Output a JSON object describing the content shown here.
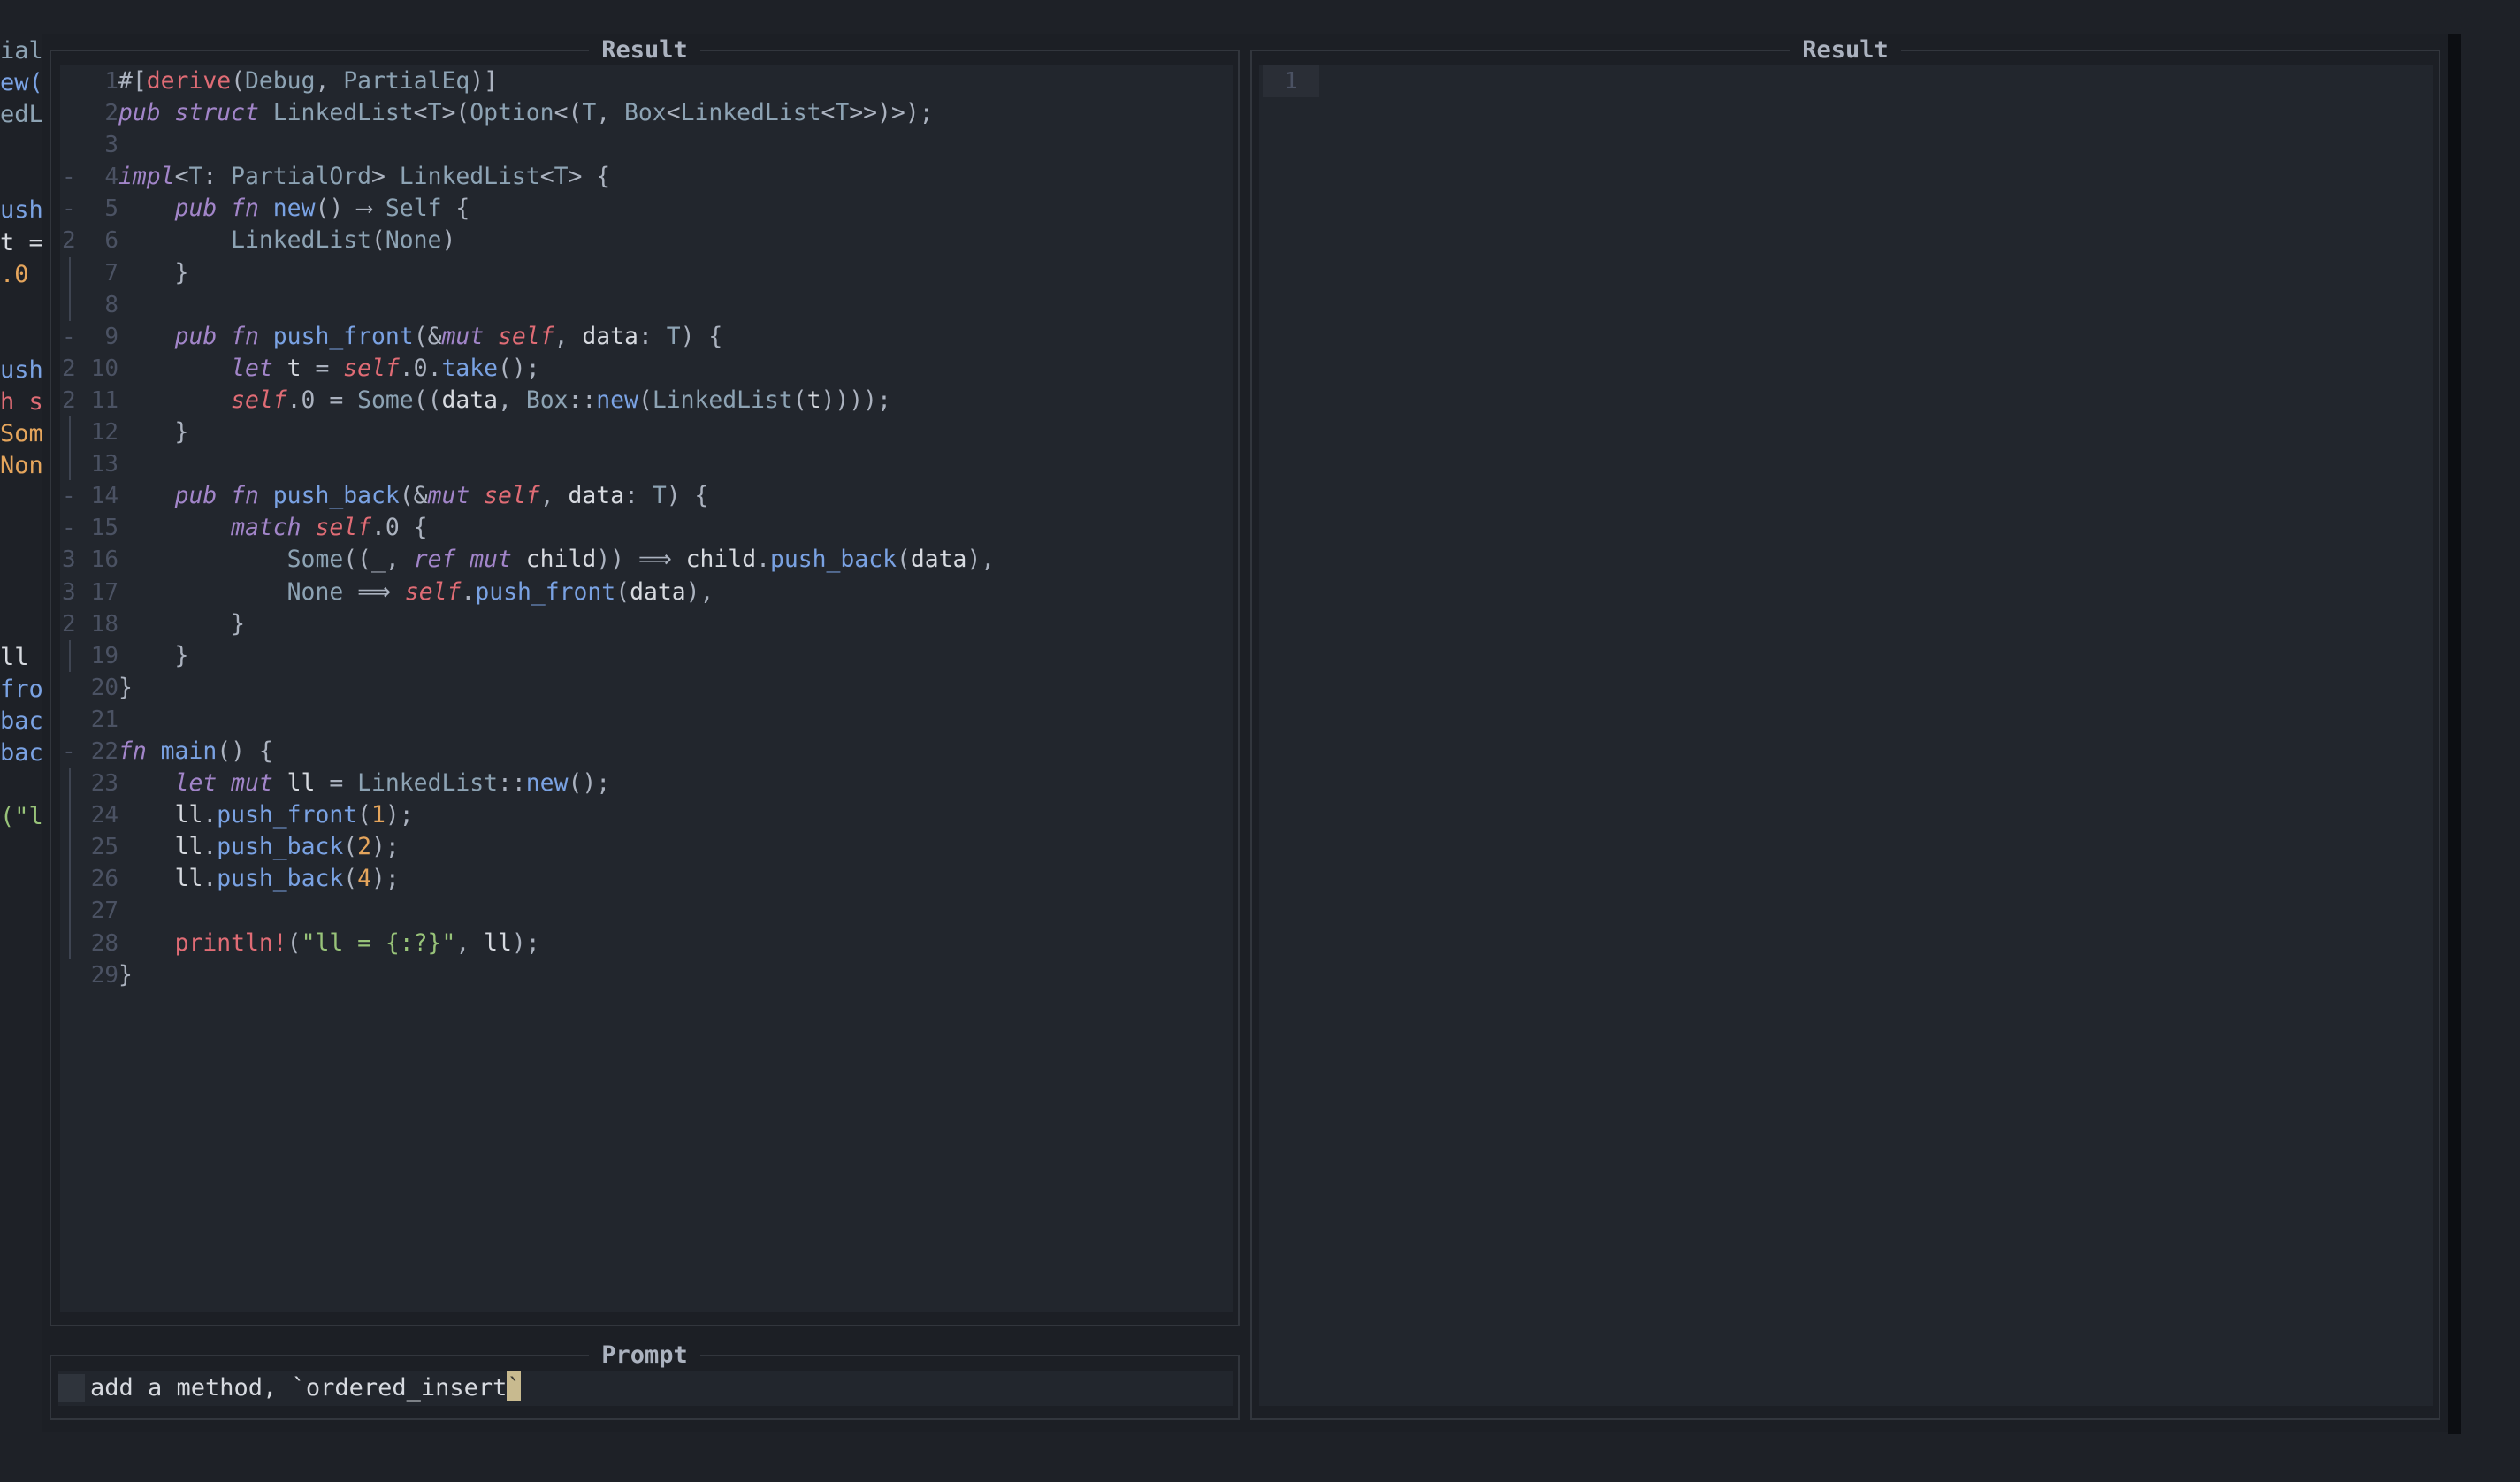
{
  "left_sliver": [
    {
      "text": "ial",
      "color": "#8da3b4"
    },
    {
      "text": "ew(",
      "color": "#7aa2e3"
    },
    {
      "text": "edL",
      "color": "#8da3b4"
    },
    {
      "text": "",
      "color": "#abb2bf"
    },
    {
      "text": "",
      "color": "#abb2bf"
    },
    {
      "text": "ush",
      "color": "#7aa2e3"
    },
    {
      "text": "t =",
      "color": "#d7dae0"
    },
    {
      "text": ".0",
      "color": "#e5a55c"
    },
    {
      "text": "",
      "color": "#abb2bf"
    },
    {
      "text": "",
      "color": "#abb2bf"
    },
    {
      "text": "ush",
      "color": "#7aa2e3"
    },
    {
      "text": "h s",
      "color": "#e06c75"
    },
    {
      "text": "Som",
      "color": "#e5a55c"
    },
    {
      "text": "Non",
      "color": "#e5a55c"
    },
    {
      "text": "",
      "color": "#abb2bf"
    },
    {
      "text": "",
      "color": "#abb2bf"
    },
    {
      "text": "",
      "color": "#abb2bf"
    },
    {
      "text": "",
      "color": "#abb2bf"
    },
    {
      "text": "",
      "color": "#abb2bf"
    },
    {
      "text": "ll",
      "color": "#d7dae0"
    },
    {
      "text": "fro",
      "color": "#7aa2e3"
    },
    {
      "text": "bac",
      "color": "#7aa2e3"
    },
    {
      "text": "bac",
      "color": "#7aa2e3"
    },
    {
      "text": "",
      "color": "#abb2bf"
    },
    {
      "text": "(\"l",
      "color": "#98c379"
    }
  ],
  "left_panel": {
    "title": "Result",
    "code_lines": [
      {
        "num": "1",
        "mark": "",
        "bar": false,
        "tokens": [
          [
            "#[",
            "pu"
          ],
          [
            "derive",
            "mac"
          ],
          [
            "(",
            "pu"
          ],
          [
            "Debug",
            "ty"
          ],
          [
            ", ",
            "pu"
          ],
          [
            "PartialEq",
            "ty"
          ],
          [
            ")]",
            "pu"
          ]
        ]
      },
      {
        "num": "2",
        "mark": "",
        "bar": false,
        "tokens": [
          [
            "pub struct ",
            "kw"
          ],
          [
            "LinkedList",
            "ty"
          ],
          [
            "<",
            "pu"
          ],
          [
            "T",
            "ty"
          ],
          [
            ">(",
            "pu"
          ],
          [
            "Option",
            "ty"
          ],
          [
            "<(",
            "pu"
          ],
          [
            "T",
            "ty"
          ],
          [
            ", ",
            "pu"
          ],
          [
            "Box",
            "ty"
          ],
          [
            "<",
            "pu"
          ],
          [
            "LinkedList",
            "ty"
          ],
          [
            "<",
            "pu"
          ],
          [
            "T",
            "ty"
          ],
          [
            ">>)>);",
            "pu"
          ]
        ]
      },
      {
        "num": "3",
        "mark": "",
        "bar": false,
        "tokens": []
      },
      {
        "num": "4",
        "mark": "-",
        "bar": false,
        "tokens": [
          [
            "impl",
            "kw"
          ],
          [
            "<",
            "pu"
          ],
          [
            "T",
            "ty"
          ],
          [
            ": ",
            "pu"
          ],
          [
            "PartialOrd",
            "ty"
          ],
          [
            "> ",
            "pu"
          ],
          [
            "LinkedList",
            "ty"
          ],
          [
            "<",
            "pu"
          ],
          [
            "T",
            "ty"
          ],
          [
            "> {",
            "pu"
          ]
        ]
      },
      {
        "num": "5",
        "mark": "-",
        "bar": false,
        "tokens": [
          [
            "    ",
            "pu"
          ],
          [
            "pub fn ",
            "kw"
          ],
          [
            "new",
            "fn"
          ],
          [
            "() ⟶ ",
            "pu"
          ],
          [
            "Self",
            "ty"
          ],
          [
            " {",
            "pu"
          ]
        ]
      },
      {
        "num": "6",
        "mark": "2",
        "bar": false,
        "tokens": [
          [
            "        ",
            "pu"
          ],
          [
            "LinkedList",
            "ty"
          ],
          [
            "(",
            "pu"
          ],
          [
            "None",
            "ty"
          ],
          [
            ")",
            "pu"
          ]
        ]
      },
      {
        "num": "7",
        "mark": "",
        "bar": true,
        "tokens": [
          [
            "    }",
            "pu"
          ]
        ]
      },
      {
        "num": "8",
        "mark": "",
        "bar": true,
        "tokens": []
      },
      {
        "num": "9",
        "mark": "-",
        "bar": false,
        "tokens": [
          [
            "    ",
            "pu"
          ],
          [
            "pub fn ",
            "kw"
          ],
          [
            "push_front",
            "fn"
          ],
          [
            "(&",
            "pu"
          ],
          [
            "mut ",
            "kw"
          ],
          [
            "self",
            "self"
          ],
          [
            ", ",
            "pu"
          ],
          [
            "data",
            "idt"
          ],
          [
            ": ",
            "pu"
          ],
          [
            "T",
            "ty"
          ],
          [
            ") {",
            "pu"
          ]
        ]
      },
      {
        "num": "10",
        "mark": "2",
        "bar": false,
        "tokens": [
          [
            "        ",
            "pu"
          ],
          [
            "let ",
            "kw"
          ],
          [
            "t",
            "idt"
          ],
          [
            " = ",
            "pu"
          ],
          [
            "self",
            "self"
          ],
          [
            ".0.",
            "pu"
          ],
          [
            "take",
            "fn"
          ],
          [
            "();",
            "pu"
          ]
        ]
      },
      {
        "num": "11",
        "mark": "2",
        "bar": false,
        "tokens": [
          [
            "        ",
            "pu"
          ],
          [
            "self",
            "self"
          ],
          [
            ".0 = ",
            "pu"
          ],
          [
            "Some",
            "ty"
          ],
          [
            "((",
            "pu"
          ],
          [
            "data",
            "idt"
          ],
          [
            ", ",
            "pu"
          ],
          [
            "Box",
            "ty"
          ],
          [
            "::",
            "pu"
          ],
          [
            "new",
            "fn"
          ],
          [
            "(",
            "pu"
          ],
          [
            "LinkedList",
            "ty"
          ],
          [
            "(",
            "pu"
          ],
          [
            "t",
            "idt"
          ],
          [
            "))));",
            "pu"
          ]
        ]
      },
      {
        "num": "12",
        "mark": "",
        "bar": true,
        "tokens": [
          [
            "    }",
            "pu"
          ]
        ]
      },
      {
        "num": "13",
        "mark": "",
        "bar": true,
        "tokens": []
      },
      {
        "num": "14",
        "mark": "-",
        "bar": false,
        "tokens": [
          [
            "    ",
            "pu"
          ],
          [
            "pub fn ",
            "kw"
          ],
          [
            "push_back",
            "fn"
          ],
          [
            "(&",
            "pu"
          ],
          [
            "mut ",
            "kw"
          ],
          [
            "self",
            "self"
          ],
          [
            ", ",
            "pu"
          ],
          [
            "data",
            "idt"
          ],
          [
            ": ",
            "pu"
          ],
          [
            "T",
            "ty"
          ],
          [
            ") {",
            "pu"
          ]
        ]
      },
      {
        "num": "15",
        "mark": "-",
        "bar": false,
        "tokens": [
          [
            "        ",
            "pu"
          ],
          [
            "match ",
            "kw"
          ],
          [
            "self",
            "self"
          ],
          [
            ".0 {",
            "pu"
          ]
        ]
      },
      {
        "num": "16",
        "mark": "3",
        "bar": false,
        "tokens": [
          [
            "            ",
            "pu"
          ],
          [
            "Some",
            "ty"
          ],
          [
            "((_, ",
            "pu"
          ],
          [
            "ref mut ",
            "kw"
          ],
          [
            "child",
            "idt"
          ],
          [
            ")) ⟹ ",
            "pu"
          ],
          [
            "child",
            "idt"
          ],
          [
            ".",
            "pu"
          ],
          [
            "push_back",
            "fn"
          ],
          [
            "(",
            "pu"
          ],
          [
            "data",
            "idt"
          ],
          [
            "),",
            "pu"
          ]
        ]
      },
      {
        "num": "17",
        "mark": "3",
        "bar": false,
        "tokens": [
          [
            "            ",
            "pu"
          ],
          [
            "None",
            "ty"
          ],
          [
            " ⟹ ",
            "pu"
          ],
          [
            "self",
            "self"
          ],
          [
            ".",
            "pu"
          ],
          [
            "push_front",
            "fn"
          ],
          [
            "(",
            "pu"
          ],
          [
            "data",
            "idt"
          ],
          [
            "),",
            "pu"
          ]
        ]
      },
      {
        "num": "18",
        "mark": "2",
        "bar": false,
        "tokens": [
          [
            "        }",
            "pu"
          ]
        ]
      },
      {
        "num": "19",
        "mark": "",
        "bar": true,
        "tokens": [
          [
            "    }",
            "pu"
          ]
        ]
      },
      {
        "num": "20",
        "mark": "",
        "bar": false,
        "tokens": [
          [
            "}",
            "pu"
          ]
        ]
      },
      {
        "num": "21",
        "mark": "",
        "bar": false,
        "tokens": []
      },
      {
        "num": "22",
        "mark": "-",
        "bar": false,
        "tokens": [
          [
            "fn ",
            "kw"
          ],
          [
            "main",
            "fn"
          ],
          [
            "() {",
            "pu"
          ]
        ]
      },
      {
        "num": "23",
        "mark": "",
        "bar": true,
        "tokens": [
          [
            "    ",
            "pu"
          ],
          [
            "let mut ",
            "kw"
          ],
          [
            "ll",
            "idt"
          ],
          [
            " = ",
            "pu"
          ],
          [
            "LinkedList",
            "ty"
          ],
          [
            "::",
            "pu"
          ],
          [
            "new",
            "fn"
          ],
          [
            "();",
            "pu"
          ]
        ]
      },
      {
        "num": "24",
        "mark": "",
        "bar": true,
        "tokens": [
          [
            "    ",
            "pu"
          ],
          [
            "ll",
            "idt"
          ],
          [
            ".",
            "pu"
          ],
          [
            "push_front",
            "fn"
          ],
          [
            "(",
            "pu"
          ],
          [
            "1",
            "num-l"
          ],
          [
            ");",
            "pu"
          ]
        ]
      },
      {
        "num": "25",
        "mark": "",
        "bar": true,
        "tokens": [
          [
            "    ",
            "pu"
          ],
          [
            "ll",
            "idt"
          ],
          [
            ".",
            "pu"
          ],
          [
            "push_back",
            "fn"
          ],
          [
            "(",
            "pu"
          ],
          [
            "2",
            "num-l"
          ],
          [
            ");",
            "pu"
          ]
        ]
      },
      {
        "num": "26",
        "mark": "",
        "bar": true,
        "tokens": [
          [
            "    ",
            "pu"
          ],
          [
            "ll",
            "idt"
          ],
          [
            ".",
            "pu"
          ],
          [
            "push_back",
            "fn"
          ],
          [
            "(",
            "pu"
          ],
          [
            "4",
            "num-l"
          ],
          [
            ");",
            "pu"
          ]
        ]
      },
      {
        "num": "27",
        "mark": "",
        "bar": true,
        "tokens": []
      },
      {
        "num": "28",
        "mark": "",
        "bar": true,
        "tokens": [
          [
            "    ",
            "pu"
          ],
          [
            "println!",
            "mac"
          ],
          [
            "(",
            "pu"
          ],
          [
            "\"ll = {:?}\"",
            "str"
          ],
          [
            ", ",
            "pu"
          ],
          [
            "ll",
            "idt"
          ],
          [
            ");",
            "pu"
          ]
        ]
      },
      {
        "num": "29",
        "mark": "",
        "bar": false,
        "tokens": [
          [
            "}",
            "pu"
          ]
        ]
      }
    ]
  },
  "prompt": {
    "title": "Prompt",
    "value": "add a method, `ordered_insert",
    "cursor_char": "`"
  },
  "right_panel": {
    "title": "Result",
    "line_number": "1"
  },
  "colors": {
    "background": "#1e2127",
    "editor_bg": "#22262d",
    "keyword": "#a285c9",
    "function": "#7aa2e3",
    "self": "#e06c75",
    "number": "#e5a55c",
    "string": "#98c379",
    "cursor": "#c8ba8f"
  }
}
